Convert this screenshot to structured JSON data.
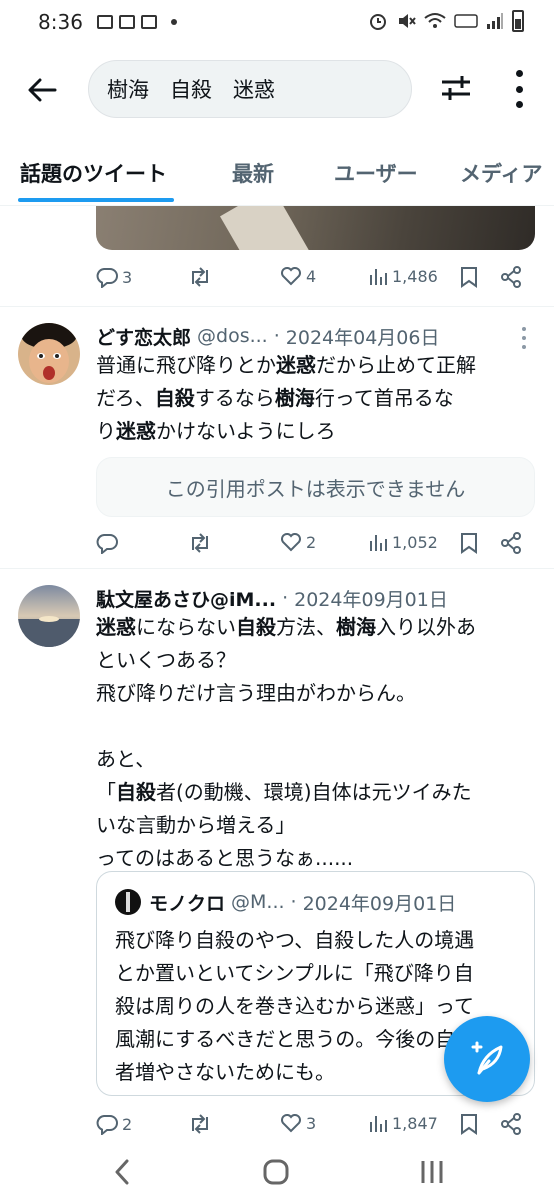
{
  "status_bar": {
    "time": "8:36"
  },
  "search": {
    "query": "樹海　自殺　迷惑"
  },
  "tabs": [
    {
      "label": "話題のツイート",
      "active": true
    },
    {
      "label": "最新",
      "active": false
    },
    {
      "label": "ユーザー",
      "active": false
    },
    {
      "label": "メディア",
      "active": false
    }
  ],
  "prev_tweet": {
    "stats": {
      "replies": "3",
      "retweets": "",
      "likes": "4",
      "views": "1,486"
    }
  },
  "tweet1": {
    "name": "どす恋太郎",
    "handle": "@dos...",
    "separator": "·",
    "date": "2024年04月06日",
    "body_lines": [
      [
        "普通に飛び降りとか",
        "迷惑",
        "だから止めて正解"
      ],
      [
        "だろ、",
        "自殺",
        "するなら",
        "樹海",
        "行って首吊るな"
      ],
      [
        "り",
        "迷惑",
        "かけないようにしろ"
      ]
    ],
    "unavailable_text": "この引用ポストは表示できません",
    "stats": {
      "replies": "",
      "retweets": "",
      "likes": "2",
      "views": "1,052"
    }
  },
  "tweet2": {
    "name": "駄文屋あさひ@iM...",
    "separator": "·",
    "date": "2024年09月01日",
    "body_lines": [
      {
        "line": 1,
        "t0": "迷惑",
        "t1": "にならない",
        "t2": "自殺",
        "t3": "方法、",
        "t4": "樹海",
        "t5": "入り以外あ"
      },
      {
        "line": 2,
        "text": "といくつある？"
      },
      {
        "line": 3,
        "text": "飛び降りだけ言う理由がわからん。"
      },
      {
        "line": 4,
        "text": ""
      },
      {
        "line": 5,
        "text": "あと、"
      },
      {
        "line": 6,
        "t0": "「",
        "t1": "自殺",
        "t2": "者(の動機、環境)自体は元ツイみた"
      },
      {
        "line": 7,
        "text": "いな言動から増える」"
      },
      {
        "line": 8,
        "text": "ってのはあると思うなぁ......"
      }
    ],
    "quote": {
      "name": "モノクロ",
      "handle": "@M...",
      "separator": "·",
      "date": "2024年09月01日",
      "lines": [
        "飛び降り自殺のやつ、自殺した人の境遇",
        "とか置いといてシンプルに「飛び降り自",
        "殺は周りの人を巻き込むから迷惑」って",
        "風潮にするべきだと思うの。今後の自殺",
        "者増やさないためにも。"
      ]
    },
    "stats": {
      "replies": "2",
      "retweets": "",
      "likes": "3",
      "views": "1,847"
    }
  },
  "icons": {
    "back": "arrow-left-icon",
    "filter": "sliders-icon",
    "more": "more-vertical-icon",
    "compose": "compose-post-icon"
  },
  "colors": {
    "accent": "#1d9bf0",
    "text": "#0f1419",
    "muted": "#536471"
  }
}
